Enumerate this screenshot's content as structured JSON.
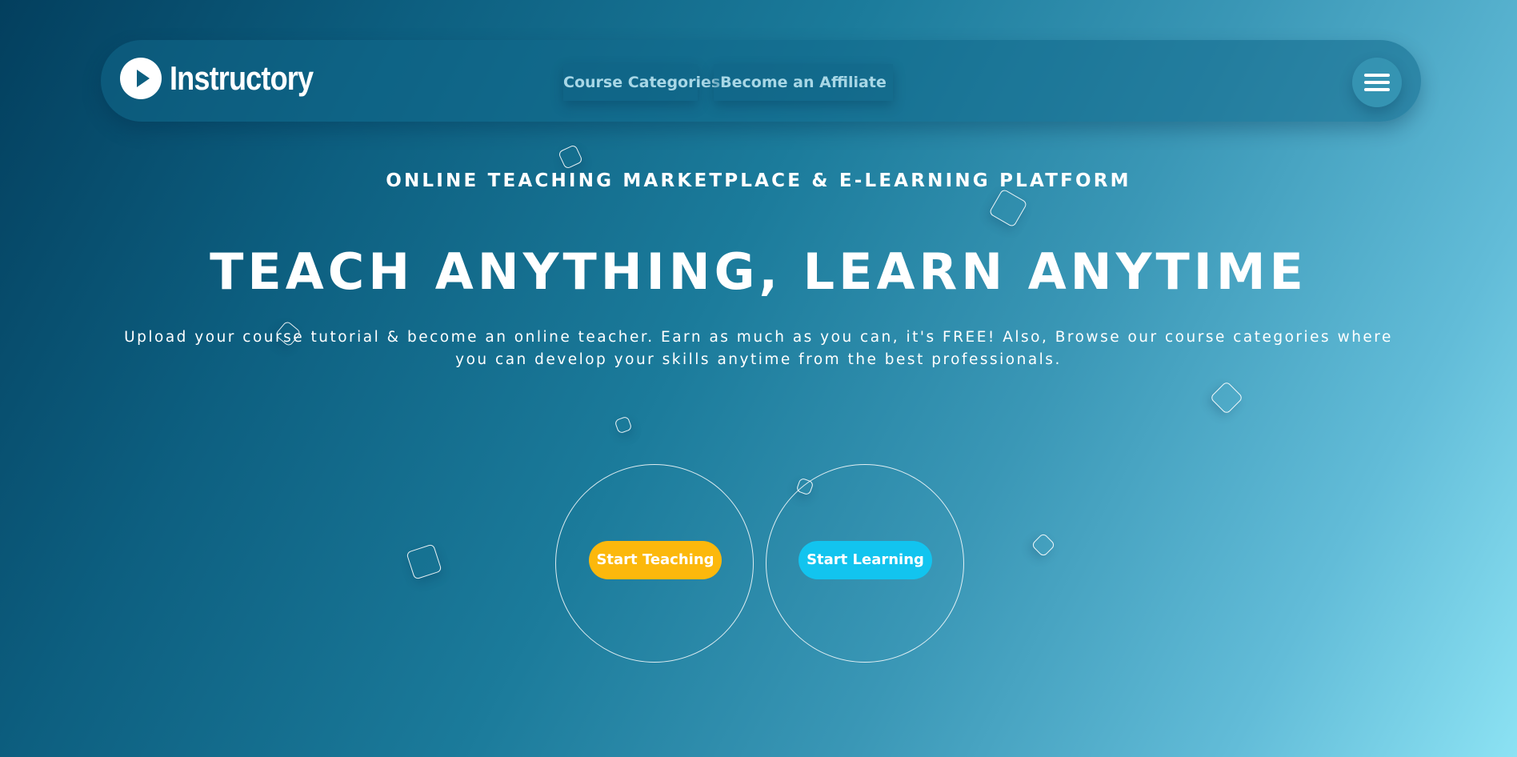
{
  "brand": {
    "name": "Instructory",
    "icon": "play-circle-icon"
  },
  "nav": {
    "links": [
      {
        "label": "Course Categories"
      },
      {
        "label": "Become an Affiliate"
      }
    ],
    "menu_icon": "hamburger-menu-icon"
  },
  "hero": {
    "eyebrow": "ONLINE TEACHING MARKETPLACE & E-LEARNING PLATFORM",
    "headline": "TEACH ANYTHING, LEARN ANYTIME",
    "subtitle": "Upload your course tutorial & become an online teacher. Earn as much as you can, it's FREE! Also, Browse our course categories where you can develop your skills anytime from the best professionals."
  },
  "cta": {
    "teach_label": "Start Teaching",
    "learn_label": "Start Learning"
  },
  "colors": {
    "background_start": "#033f5e",
    "background_end": "#8ce2f3",
    "teach_button": "#fcb80c",
    "learn_button": "#12c4ef",
    "nav_link_text": "#a8d7e6"
  }
}
